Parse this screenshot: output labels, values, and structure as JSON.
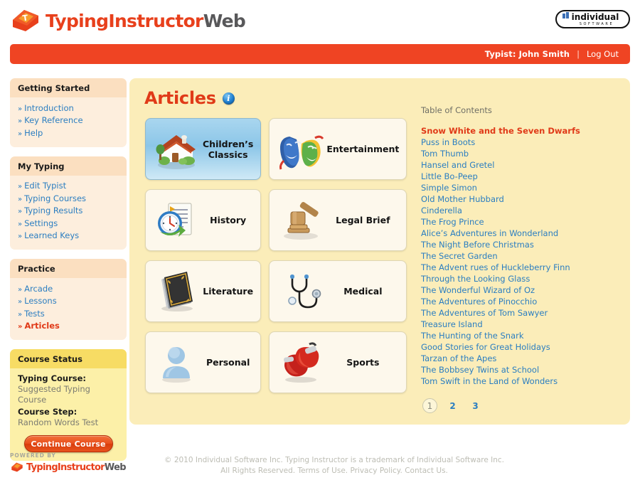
{
  "header": {
    "brand_primary": "TypingInstructor",
    "brand_secondary": "Web",
    "corp_logo_name": "individual",
    "corp_logo_sub": "S O F T W A R E"
  },
  "userbar": {
    "typist": "Typist: John Smith",
    "separator": "|",
    "logout": "Log Out"
  },
  "sidebar": {
    "sections": [
      {
        "title": "Getting Started",
        "style": "peach",
        "items": [
          {
            "label": "Introduction",
            "active": false
          },
          {
            "label": "Key Reference",
            "active": false
          },
          {
            "label": "Help",
            "active": false
          }
        ]
      },
      {
        "title": "My Typing",
        "style": "peach",
        "items": [
          {
            "label": "Edit Typist",
            "active": false
          },
          {
            "label": "Typing Courses",
            "active": false
          },
          {
            "label": "Typing Results",
            "active": false
          },
          {
            "label": "Settings",
            "active": false
          },
          {
            "label": "Learned Keys",
            "active": false
          }
        ]
      },
      {
        "title": "Practice",
        "style": "peach",
        "items": [
          {
            "label": "Arcade",
            "active": false
          },
          {
            "label": "Lessons",
            "active": false
          },
          {
            "label": "Tests",
            "active": false
          },
          {
            "label": "Articles",
            "active": true
          }
        ]
      }
    ],
    "course_status": {
      "title": "Course Status",
      "course_label": "Typing Course:",
      "course_value": "Suggested Typing Course",
      "step_label": "Course Step:",
      "step_value": "Random Words Test",
      "button": "Continue Course"
    }
  },
  "main": {
    "title": "Articles",
    "info_icon": "i",
    "categories": [
      {
        "label": "Children’s Classics",
        "icon": "house-icon",
        "selected": true
      },
      {
        "label": "Entertainment",
        "icon": "theater-masks-icon",
        "selected": false
      },
      {
        "label": "History",
        "icon": "clock-document-icon",
        "selected": false
      },
      {
        "label": "Legal Brief",
        "icon": "gavel-icon",
        "selected": false
      },
      {
        "label": "Literature",
        "icon": "book-icon",
        "selected": false
      },
      {
        "label": "Medical",
        "icon": "stethoscope-icon",
        "selected": false
      },
      {
        "label": "Personal",
        "icon": "person-icon",
        "selected": false
      },
      {
        "label": "Sports",
        "icon": "boxing-gloves-icon",
        "selected": false
      }
    ],
    "toc": {
      "title": "Table of Contents",
      "entries": [
        {
          "label": "Snow White and the Seven Dwarfs",
          "active": true
        },
        {
          "label": "Puss in Boots",
          "active": false
        },
        {
          "label": "Tom Thumb",
          "active": false
        },
        {
          "label": "Hansel and Gretel",
          "active": false
        },
        {
          "label": "Little Bo-Peep",
          "active": false
        },
        {
          "label": "Simple Simon",
          "active": false
        },
        {
          "label": "Old Mother Hubbard",
          "active": false
        },
        {
          "label": "Cinderella",
          "active": false
        },
        {
          "label": "The Frog Prince",
          "active": false
        },
        {
          "label": "Alice’s Adventures in Wonderland",
          "active": false
        },
        {
          "label": "The Night Before Christmas",
          "active": false
        },
        {
          "label": "The Secret Garden",
          "active": false
        },
        {
          "label": "The Advent rues of Huckleberry Finn",
          "active": false
        },
        {
          "label": "Through the Looking Glass",
          "active": false
        },
        {
          "label": "The Wonderful Wizard of Oz",
          "active": false
        },
        {
          "label": "The Adventures of Pinocchio",
          "active": false
        },
        {
          "label": "The Adventures of Tom Sawyer",
          "active": false
        },
        {
          "label": "Treasure Island",
          "active": false
        },
        {
          "label": "The Hunting of the Snark",
          "active": false
        },
        {
          "label": "Good Stories for Great Holidays",
          "active": false
        },
        {
          "label": "Tarzan of the Apes",
          "active": false
        },
        {
          "label": "The Bobbsey Twins at School",
          "active": false
        },
        {
          "label": "Tom Swift in the Land of Wonders",
          "active": false
        }
      ],
      "pages": [
        {
          "label": "1",
          "current": true
        },
        {
          "label": "2",
          "current": false
        },
        {
          "label": "3",
          "current": false
        }
      ]
    }
  },
  "footer": {
    "powered_by": "POWERED BY",
    "brand_primary": "TypingInstructor",
    "brand_secondary": "Web",
    "copyright_line1": "© 2010 Individual Software Inc. Typing Instructor is a trademark of Individual Software Inc.",
    "copyright_line2": "All Rights Reserved. Terms of Use. Privacy Policy. Contact Us."
  },
  "colors": {
    "accent_red": "#e03a18",
    "bar_red": "#ef4423",
    "link_blue": "#2b7ec1",
    "panel_yellow": "#fbedb9",
    "status_yellow": "#f7dc64"
  }
}
